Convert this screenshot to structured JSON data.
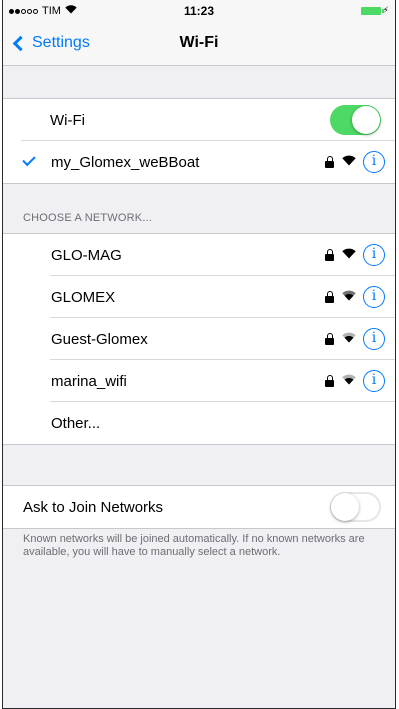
{
  "status_bar": {
    "carrier": "TIM",
    "time": "11:23"
  },
  "nav": {
    "back_label": "Settings",
    "title": "Wi-Fi"
  },
  "wifi_row": {
    "label": "Wi-Fi",
    "enabled": true
  },
  "connected": {
    "name": "my_Glomex_weBBoat",
    "icons": [
      "lock-icon",
      "wifi-icon",
      "info-icon"
    ]
  },
  "choose_header": "CHOOSE A NETWORK...",
  "networks": [
    {
      "name": "GLO-MAG",
      "secured": true
    },
    {
      "name": "GLOMEX",
      "secured": true
    },
    {
      "name": "Guest-Glomex",
      "secured": true
    },
    {
      "name": "marina_wifi",
      "secured": true
    },
    {
      "name": "Other..."
    }
  ],
  "ask_join": {
    "label": "Ask to Join Networks",
    "enabled": false
  },
  "footer_text": "Known networks will be joined automatically. If no known networks are available, you will have to manually select a network.",
  "colors": {
    "accent": "#007aff",
    "toggle_on": "#4cd964",
    "background": "#efeff4"
  }
}
